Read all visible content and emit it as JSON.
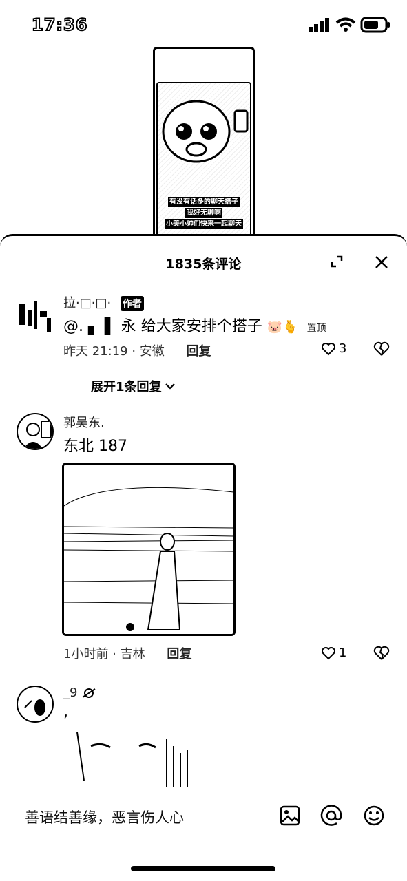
{
  "status_bar": {
    "time": "17:36"
  },
  "video": {
    "caption_lines": [
      "有没有话多的聊天搭子",
      "我好无聊啊",
      "小美小帅们快来一起聊天"
    ]
  },
  "sheet": {
    "title": "1835条评论"
  },
  "comments": [
    {
      "username": "拉·□·□·",
      "badge": "作者",
      "text": "@. ▖ ▌ 永 给大家安排个搭子",
      "emoji": "🐷🫰",
      "pinned": "置顶",
      "time_location": "昨天 21:19 · 安徽",
      "reply": "回复",
      "likes": "3"
    },
    {
      "username": "郭吴东.",
      "text": "东北 187",
      "time_location": "1小时前 · 吉林",
      "reply": "回复",
      "likes": "1"
    },
    {
      "username": "_9",
      "text": ","
    }
  ],
  "expand_replies": "展开1条回复",
  "input": {
    "placeholder": "善语结善缘，恶言伤人心"
  }
}
